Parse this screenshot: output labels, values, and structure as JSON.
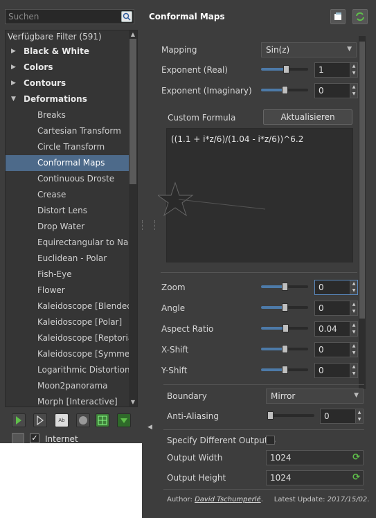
{
  "search": {
    "placeholder": "Suchen"
  },
  "tree": {
    "header": "Verfügbare Filter (591)",
    "categories": [
      {
        "label": "Black & White",
        "expanded": false
      },
      {
        "label": "Colors",
        "expanded": false
      },
      {
        "label": "Contours",
        "expanded": false
      },
      {
        "label": "Deformations",
        "expanded": true
      }
    ],
    "items": [
      {
        "label": "Breaks"
      },
      {
        "label": "Cartesian Transform"
      },
      {
        "label": "Circle Transform"
      },
      {
        "label": "Conformal Maps",
        "selected": true
      },
      {
        "label": "Continuous Droste"
      },
      {
        "label": "Crease"
      },
      {
        "label": "Distort Lens"
      },
      {
        "label": "Drop Water"
      },
      {
        "label": "Equirectangular to Nadir-"
      },
      {
        "label": "Euclidean - Polar"
      },
      {
        "label": "Fish-Eye"
      },
      {
        "label": "Flower"
      },
      {
        "label": "Kaleidoscope [Blended]"
      },
      {
        "label": "Kaleidoscope [Polar]"
      },
      {
        "label": "Kaleidoscope [Reptorian-"
      },
      {
        "label": "Kaleidoscope [Symmetry"
      },
      {
        "label": "Logarithmic Distortion"
      },
      {
        "label": "Moon2panorama"
      },
      {
        "label": "Morph [Interactive]"
      }
    ]
  },
  "toolbar": {
    "icons": [
      "add-favorite-icon",
      "remove-favorite-icon",
      "text-icon",
      "sphere-icon",
      "grid-icon",
      "download-icon"
    ]
  },
  "bottom": {
    "internet_label": "Internet",
    "internet_checked": true
  },
  "filter": {
    "title": "Conformal Maps",
    "mapping": {
      "label": "Mapping",
      "value": "Sin(z)"
    },
    "exponent_real": {
      "label": "Exponent (Real)",
      "value": "1",
      "level": 0.55
    },
    "exponent_imag": {
      "label": "Exponent (Imaginary)",
      "value": "0",
      "level": 0.5
    },
    "custom_formula": {
      "label": "Custom Formula",
      "button": "Aktualisieren",
      "text": "((1.1 + i*z/6)/(1.04 - i*z/6))^6.2"
    },
    "zoom": {
      "label": "Zoom",
      "value": "0",
      "level": 0.5
    },
    "angle": {
      "label": "Angle",
      "value": "0",
      "level": 0.5
    },
    "aspect_ratio": {
      "label": "Aspect Ratio",
      "value": "0.04",
      "level": 0.52
    },
    "x_shift": {
      "label": "X-Shift",
      "value": "0",
      "level": 0.5
    },
    "y_shift": {
      "label": "Y-Shift",
      "value": "0",
      "level": 0.5
    },
    "boundary": {
      "label": "Boundary",
      "value": "Mirror"
    },
    "anti_aliasing": {
      "label": "Anti-Aliasing",
      "value": "0",
      "level": 0.0
    },
    "specify_output": {
      "label": "Specify Different Output S",
      "checked": false
    },
    "output_width": {
      "label": "Output Width",
      "value": "1024"
    },
    "output_height": {
      "label": "Output Height",
      "value": "1024"
    },
    "author_prefix": "Author:",
    "author_name": "David Tschumperlé",
    "update_prefix": "Latest Update:",
    "update_date": "2017/15/02"
  },
  "colors": {
    "selection": "#4d6a8a",
    "accent": "#4d7aa8",
    "refresh_green": "#5fbf4a",
    "panel_bg": "#3d3d3d"
  }
}
